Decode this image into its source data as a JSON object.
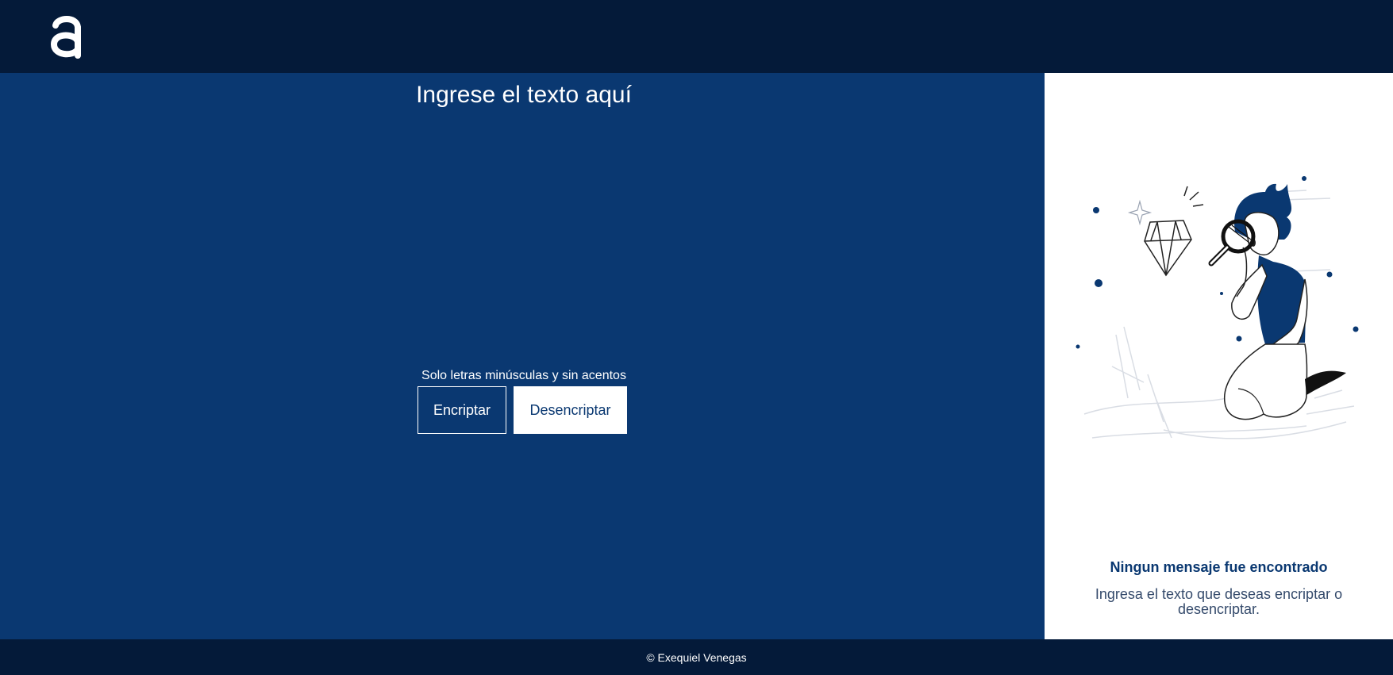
{
  "header": {
    "logo_icon": "alura-logo-icon"
  },
  "main": {
    "input_placeholder": "Ingrese el texto aquí",
    "hint": "Solo letras minúsculas y sin acentos",
    "encrypt_label": "Encriptar",
    "decrypt_label": "Desencriptar"
  },
  "side": {
    "illustration_icon": "person-magnifying-glass-diamond-illustration",
    "title": "Ningun mensaje fue encontrado",
    "text": "Ingresa el texto que deseas encriptar o desencriptar."
  },
  "footer": {
    "text": "© Exequiel Venegas"
  },
  "colors": {
    "primary": "#0a3871",
    "dark": "#041a39",
    "white": "#ffffff"
  }
}
